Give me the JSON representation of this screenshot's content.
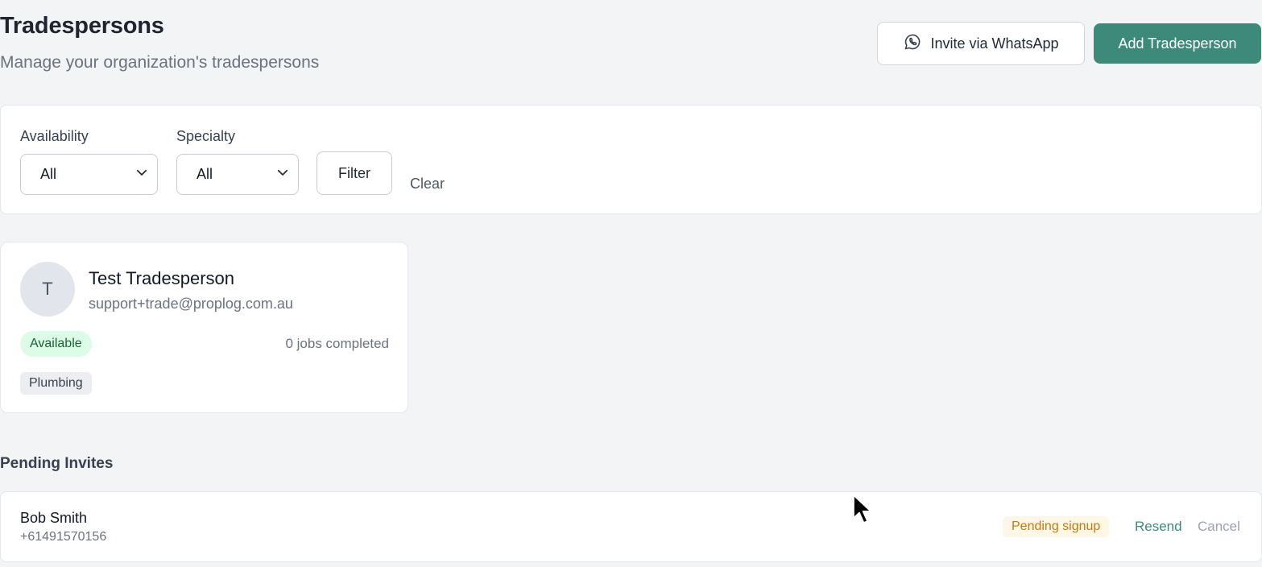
{
  "header": {
    "title": "Tradespersons",
    "subtitle": "Manage your organization's tradespersons",
    "invite_whatsapp_label": "Invite via WhatsApp",
    "add_label": "Add Tradesperson"
  },
  "filters": {
    "availability": {
      "label": "Availability",
      "value": "All"
    },
    "specialty": {
      "label": "Specialty",
      "value": "All"
    },
    "filter_label": "Filter",
    "clear_label": "Clear"
  },
  "tradespersons": [
    {
      "avatar_initial": "T",
      "name": "Test Tradesperson",
      "email": "support+trade@proplog.com.au",
      "status": "Available",
      "jobs_completed": "0 jobs completed",
      "specialties": [
        "Plumbing"
      ]
    }
  ],
  "pending_invites": {
    "title": "Pending Invites",
    "items": [
      {
        "name": "Bob Smith",
        "phone": "+61491570156",
        "status": "Pending signup",
        "resend_label": "Resend",
        "cancel_label": "Cancel"
      }
    ]
  },
  "colors": {
    "accent": "#3d8a7b",
    "available_bg": "#dcfce7",
    "available_text": "#166534",
    "pending_bg": "#fef7e6",
    "pending_text": "#c27a12"
  },
  "icons": {
    "whatsapp": "whatsapp-icon",
    "select_chevron": "chevron-down-icon",
    "cursor": "mouse-pointer-icon"
  }
}
